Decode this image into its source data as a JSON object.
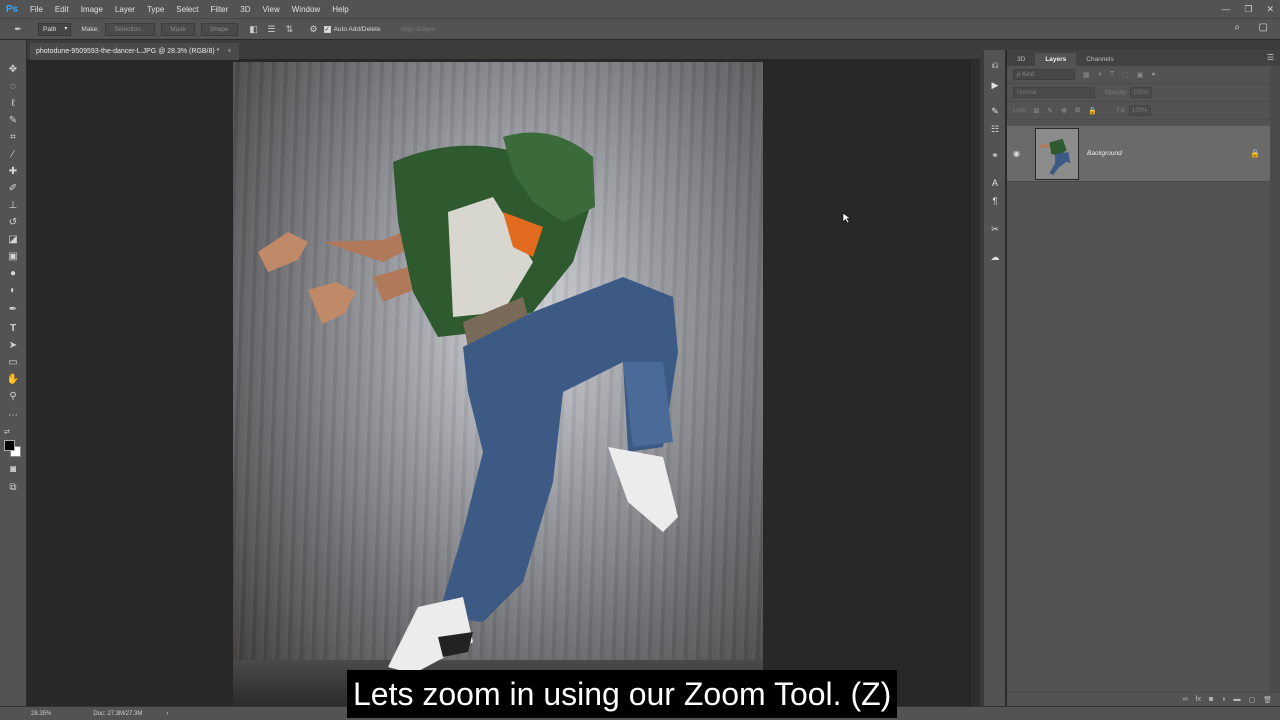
{
  "app": {
    "logo": "Ps",
    "menu": [
      "File",
      "Edit",
      "Image",
      "Layer",
      "Type",
      "Select",
      "Filter",
      "3D",
      "View",
      "Window",
      "Help"
    ],
    "window_controls": [
      "—",
      "❐",
      "✕"
    ]
  },
  "options_bar": {
    "tool_icon": "pen-icon",
    "mode_value": "Path",
    "make_label": "Make:",
    "selection_label": "Selection...",
    "mask_label": "Mask",
    "shape_label": "Shape",
    "auto_add_delete_label": "Auto Add/Delete",
    "auto_add_delete_checked": true,
    "align_edges_label": "Align Edges"
  },
  "document": {
    "tab_title": "photodune-9509593-the-dancer-L.JPG @ 28.3% (RGB/8) *",
    "close_glyph": "×"
  },
  "panels": {
    "tabs": [
      "3D",
      "Layers",
      "Channels"
    ],
    "active_tab": "Layers",
    "filter_placeholder": "ρ Kind",
    "blend_mode": "Normal",
    "opacity_label": "Opacity:",
    "opacity_value": "100%",
    "lock_label": "Lock:",
    "fill_label": "Fill:",
    "fill_value": "100%",
    "layers": [
      {
        "name": "Background",
        "visible": true,
        "locked": true
      }
    ]
  },
  "status": {
    "zoom": "28.35%",
    "doc": "Doc: 27.3M/27.3M",
    "arrow": "›"
  },
  "subtitle": "Lets zoom in using our Zoom Tool. (Z)",
  "colors": {
    "accent_ps": "#31a8ff",
    "ui_panel": "#535353",
    "canvas_bg": "#282828"
  }
}
